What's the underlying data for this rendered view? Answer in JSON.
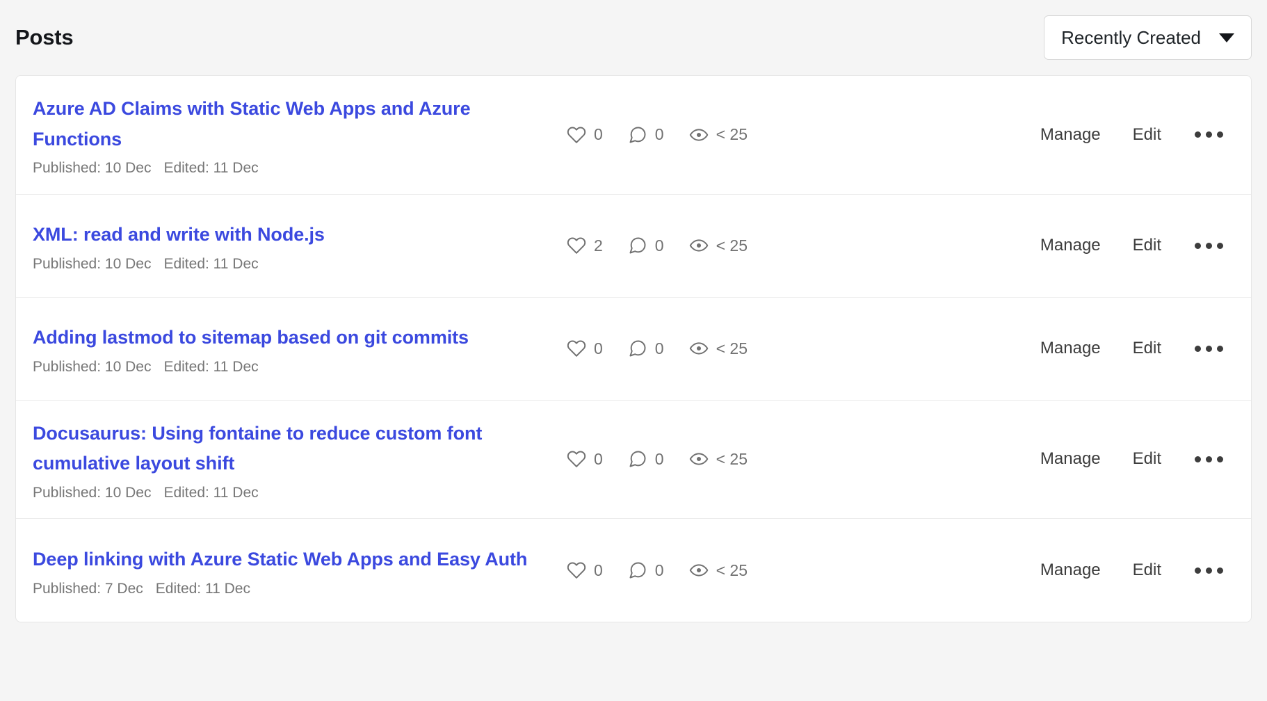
{
  "header": {
    "title": "Posts",
    "sort": {
      "selected": "Recently Created",
      "icon": "chevron-down-icon",
      "options": [
        "Recently Created"
      ]
    }
  },
  "colors": {
    "page_background": "#f5f5f5",
    "card_background": "#ffffff",
    "title_link": "#3b49df",
    "meta_text": "#767676",
    "stat_text": "#717171",
    "action_text": "#3d3d3d",
    "divider": "#ebebeb"
  },
  "stat_icons": {
    "reactions": "heart-icon",
    "comments": "comment-icon",
    "views": "eye-icon"
  },
  "actions": {
    "manage_label": "Manage",
    "edit_label": "Edit",
    "more_icon": "ellipsis-icon"
  },
  "meta_labels": {
    "published_prefix": "Published:",
    "edited_prefix": "Edited:"
  },
  "posts": [
    {
      "title": "Azure AD Claims with Static Web Apps and Azure Functions",
      "published": "Published: 10 Dec",
      "edited": "Edited: 11 Dec",
      "reactions": "0",
      "comments": "0",
      "views": "< 25",
      "manage": "Manage",
      "edit": "Edit"
    },
    {
      "title": "XML: read and write with Node.js",
      "published": "Published: 10 Dec",
      "edited": "Edited: 11 Dec",
      "reactions": "2",
      "comments": "0",
      "views": "< 25",
      "manage": "Manage",
      "edit": "Edit"
    },
    {
      "title": "Adding lastmod to sitemap based on git commits",
      "published": "Published: 10 Dec",
      "edited": "Edited: 11 Dec",
      "reactions": "0",
      "comments": "0",
      "views": "< 25",
      "manage": "Manage",
      "edit": "Edit"
    },
    {
      "title": "Docusaurus: Using fontaine to reduce custom font cumulative layout shift",
      "published": "Published: 10 Dec",
      "edited": "Edited: 11 Dec",
      "reactions": "0",
      "comments": "0",
      "views": "< 25",
      "manage": "Manage",
      "edit": "Edit"
    },
    {
      "title": "Deep linking with Azure Static Web Apps and Easy Auth",
      "published": "Published: 7 Dec",
      "edited": "Edited: 11 Dec",
      "reactions": "0",
      "comments": "0",
      "views": "< 25",
      "manage": "Manage",
      "edit": "Edit"
    }
  ]
}
